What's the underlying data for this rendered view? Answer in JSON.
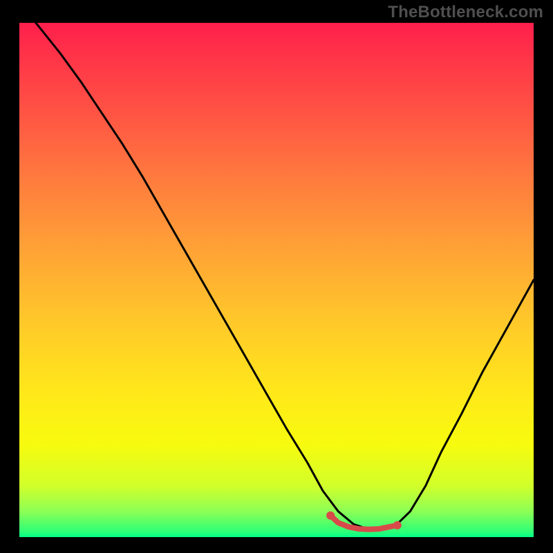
{
  "watermark": "TheBottleneck.com",
  "chart_data": {
    "type": "line",
    "title": "",
    "xlabel": "",
    "ylabel": "",
    "xlim": [
      0,
      100
    ],
    "ylim": [
      0,
      100
    ],
    "grid": false,
    "legend": false,
    "series": [
      {
        "name": "bottleneck-curve",
        "color": "#000000",
        "x": [
          0,
          4,
          8,
          12,
          16,
          20,
          24,
          28,
          32,
          36,
          40,
          44,
          48,
          52,
          56,
          59,
          62,
          65,
          68,
          71,
          73,
          76,
          79,
          82,
          86,
          90,
          95,
          100
        ],
        "y": [
          104,
          99,
          94,
          88.5,
          82.5,
          76.5,
          70,
          63,
          56,
          49,
          42,
          35,
          28,
          21,
          14.5,
          9,
          5,
          2.5,
          1.5,
          1.5,
          2.1,
          5,
          10,
          16.5,
          24,
          32,
          41,
          50
        ]
      },
      {
        "name": "optimal-zone",
        "color": "#d84a4a",
        "x": [
          60.5,
          62,
          64,
          66,
          68,
          70,
          72,
          73.5
        ],
        "y": [
          4.2,
          2.8,
          2.0,
          1.6,
          1.5,
          1.6,
          2.0,
          2.3
        ]
      }
    ],
    "markers": [
      {
        "name": "left-endpoint",
        "x": 60.5,
        "y": 4.2,
        "color": "#d84a4a"
      },
      {
        "name": "right-endpoint",
        "x": 73.5,
        "y": 2.3,
        "color": "#d84a4a"
      }
    ]
  }
}
